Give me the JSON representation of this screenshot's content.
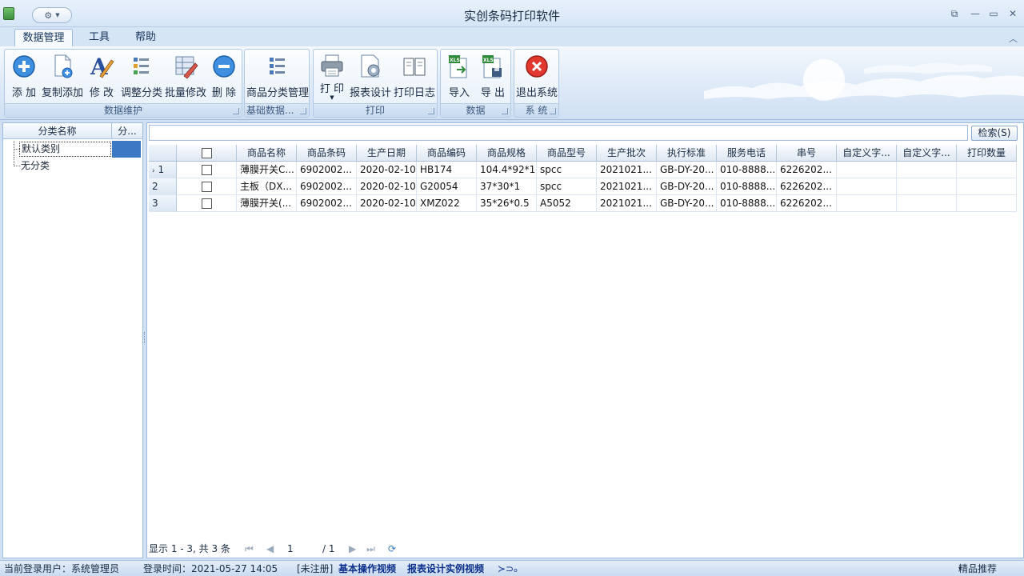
{
  "window": {
    "title": "实创条码打印软件"
  },
  "ribbon": {
    "tabs": [
      "数据管理",
      "工具",
      "帮助"
    ],
    "groups": {
      "data_maintenance": {
        "label": "数据维护",
        "buttons": {
          "add": "添 加",
          "copy_add": "复制添加",
          "edit": "修 改",
          "adjust_category": "调整分类",
          "batch_edit": "批量修改",
          "delete": "删 除"
        }
      },
      "basic_data": {
        "label": "基础数据...",
        "buttons": {
          "category_manage": "商品分类管理"
        }
      },
      "print": {
        "label": "打印",
        "buttons": {
          "print": "打 印",
          "report_design": "报表设计",
          "print_log": "打印日志"
        }
      },
      "data": {
        "label": "数据",
        "buttons": {
          "import": "导入",
          "export": "导 出"
        }
      },
      "system": {
        "label": "系 统",
        "buttons": {
          "exit": "退出系统"
        }
      }
    }
  },
  "category_panel": {
    "headers": [
      "分类名称",
      "分..."
    ],
    "items": [
      "默认类别",
      "无分类"
    ]
  },
  "search": {
    "value": "",
    "button": "检索(S)"
  },
  "table": {
    "headers": [
      "商品名称",
      "商品条码",
      "生产日期",
      "商品编码",
      "商品规格",
      "商品型号",
      "生产批次",
      "执行标准",
      "服务电话",
      "串号",
      "自定义字...",
      "自定义字...",
      "打印数量"
    ],
    "rows": [
      {
        "no": "1",
        "cells": [
          "薄膜开关C...",
          "6902002...",
          "2020-02-10",
          "HB174",
          "104.4*92*1",
          "spcc",
          "2021021...",
          "GB-DY-20...",
          "010-8888...",
          "6226202...",
          "",
          "",
          ""
        ]
      },
      {
        "no": "2",
        "cells": [
          "主板（DX...",
          "6902002...",
          "2020-02-10",
          "G20054",
          "37*30*1",
          "spcc",
          "2021021...",
          "GB-DY-20...",
          "010-8888...",
          "6226202...",
          "",
          "",
          ""
        ]
      },
      {
        "no": "3",
        "cells": [
          "薄膜开关(...",
          "6902002...",
          "2020-02-10",
          "XMZ022",
          "35*26*0.5",
          "A5052",
          "2021021...",
          "GB-DY-20...",
          "010-8888...",
          "6226202...",
          "",
          "",
          ""
        ]
      }
    ]
  },
  "pager": {
    "summary": "显示 1 - 3, 共 3 条",
    "page": "1",
    "total": "/ 1"
  },
  "status": {
    "user": "当前登录用户：系统管理员",
    "login_time": "登录时间：2021-05-27 14:05",
    "unregistered": "[未注册]",
    "link1": "基本操作视频",
    "link2": "报表设计实例视频",
    "recommend": "精品推荐"
  }
}
